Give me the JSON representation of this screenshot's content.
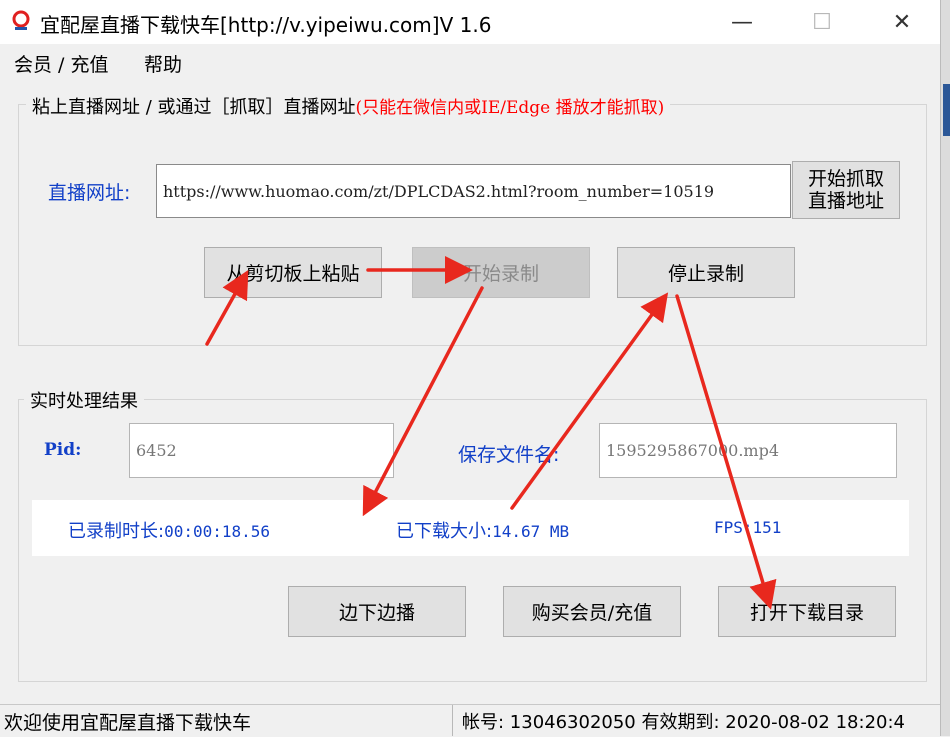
{
  "window": {
    "title": "宜配屋直播下载快车[http://v.yipeiwu.com]V 1.6",
    "minimize_glyph": "—",
    "maximize_glyph": "☐",
    "close_glyph": "✕"
  },
  "menu": {
    "items": [
      "会员 / 充值",
      "帮助"
    ]
  },
  "url_group": {
    "legend_text": "粘上直播网址 / 或通过［抓取］直播网址",
    "legend_note": "(只能在微信内或IE/Edge 播放才能抓取)",
    "url_label": "直播网址:",
    "url_value": "https://www.huomao.com/zt/DPLCDAS2.html?room_number=10519",
    "grab_button_line1": "开始抓取",
    "grab_button_line2": "直播地址",
    "paste_button": "从剪切板上粘贴",
    "start_button": "开始录制",
    "stop_button": "停止录制"
  },
  "result_group": {
    "legend_text": "实时处理结果",
    "pid_label": "Pid:",
    "pid_value": "6452",
    "file_label": "保存文件名:",
    "file_value": "1595295867000.mp4",
    "recorded_label": "已录制时长:",
    "recorded_value": "00:00:18.56",
    "downloaded_label": "已下载大小:",
    "downloaded_value": "14.67 MB",
    "fps_label": "FPS:",
    "fps_value": "151",
    "play_while_download_button": "边下边播",
    "buy_button": "购买会员/充值",
    "open_dir_button": "打开下载目录"
  },
  "statusbar": {
    "welcome": "欢迎使用宜配屋直播下载快车",
    "account": "帐号: 13046302050 有效期到: 2020-08-02 18:20:4"
  },
  "colors": {
    "label_blue": "#1240c8",
    "note_red": "#ff0000",
    "arrow_red": "#e8281e"
  },
  "annotations": {
    "arrow_count": 6
  }
}
